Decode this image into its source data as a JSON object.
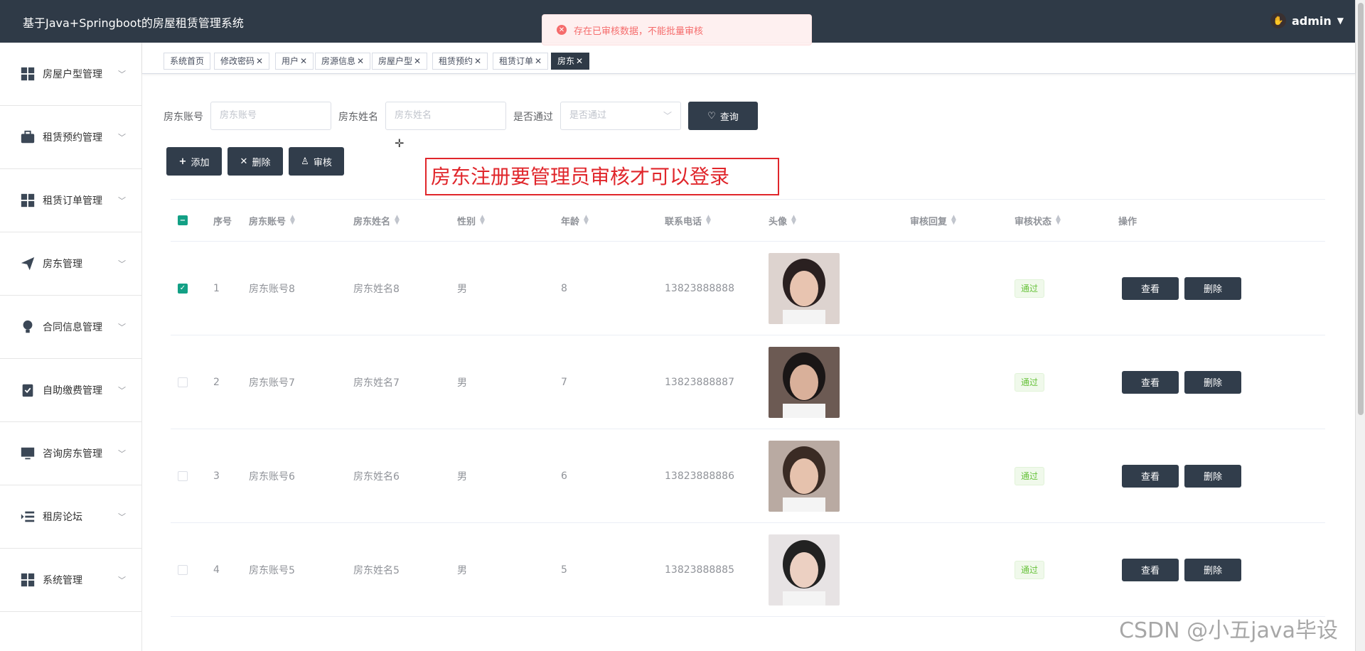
{
  "header": {
    "title": "基于Java+Springboot的房屋租赁管理系统",
    "user": "admin"
  },
  "toast": {
    "message": "存在已审核数据，不能批量审核"
  },
  "sidebar": {
    "items": [
      {
        "label": "房屋户型管理",
        "icon": "grid-icon"
      },
      {
        "label": "租赁预约管理",
        "icon": "briefcase-icon"
      },
      {
        "label": "租赁订单管理",
        "icon": "grid-icon"
      },
      {
        "label": "房东管理",
        "icon": "paper-plane-icon"
      },
      {
        "label": "合同信息管理",
        "icon": "lightbulb-icon"
      },
      {
        "label": "自助缴费管理",
        "icon": "clipboard-check-icon"
      },
      {
        "label": "咨询房东管理",
        "icon": "monitor-icon"
      },
      {
        "label": "租房论坛",
        "icon": "list-indent-icon"
      },
      {
        "label": "系统管理",
        "icon": "grid-icon"
      }
    ]
  },
  "tags": [
    {
      "label": "系统首页",
      "closable": false
    },
    {
      "label": "修改密码",
      "closable": true
    },
    {
      "label": "用户",
      "closable": true
    },
    {
      "label": "房源信息",
      "closable": true
    },
    {
      "label": "房屋户型",
      "closable": true
    },
    {
      "label": "租赁预约",
      "closable": true
    },
    {
      "label": "租赁订单",
      "closable": true
    },
    {
      "label": "房东",
      "closable": true,
      "active": true
    }
  ],
  "search": {
    "account_label": "房东账号",
    "account_placeholder": "房东账号",
    "name_label": "房东姓名",
    "name_placeholder": "房东姓名",
    "pass_label": "是否通过",
    "pass_placeholder": "是否通过",
    "query_label": "查询"
  },
  "actions": {
    "add": "添加",
    "delete": "删除",
    "audit": "审核"
  },
  "annotation": "房东注册要管理员审核才可以登录",
  "table": {
    "columns": [
      "序号",
      "房东账号",
      "房东姓名",
      "性别",
      "年龄",
      "联系电话",
      "头像",
      "审核回复",
      "审核状态",
      "操作"
    ],
    "rows": [
      {
        "checked": true,
        "no": "1",
        "account": "房东账号8",
        "name": "房东姓名8",
        "gender": "男",
        "age": "8",
        "phone": "13823888888",
        "status": "通过"
      },
      {
        "checked": false,
        "no": "2",
        "account": "房东账号7",
        "name": "房东姓名7",
        "gender": "男",
        "age": "7",
        "phone": "13823888887",
        "status": "通过"
      },
      {
        "checked": false,
        "no": "3",
        "account": "房东账号6",
        "name": "房东姓名6",
        "gender": "男",
        "age": "6",
        "phone": "13823888886",
        "status": "通过"
      },
      {
        "checked": false,
        "no": "4",
        "account": "房东账号5",
        "name": "房东姓名5",
        "gender": "男",
        "age": "5",
        "phone": "13823888885",
        "status": "通过"
      }
    ],
    "view_label": "查看",
    "delete_label": "删除"
  },
  "watermark": "CSDN @小五java毕设",
  "colors": {
    "header_bg": "#2f3a47",
    "accent": "#313d4b",
    "check": "#13a085",
    "error": "#f56c6c",
    "annotation": "#e0262b",
    "success": "#67c23a"
  }
}
